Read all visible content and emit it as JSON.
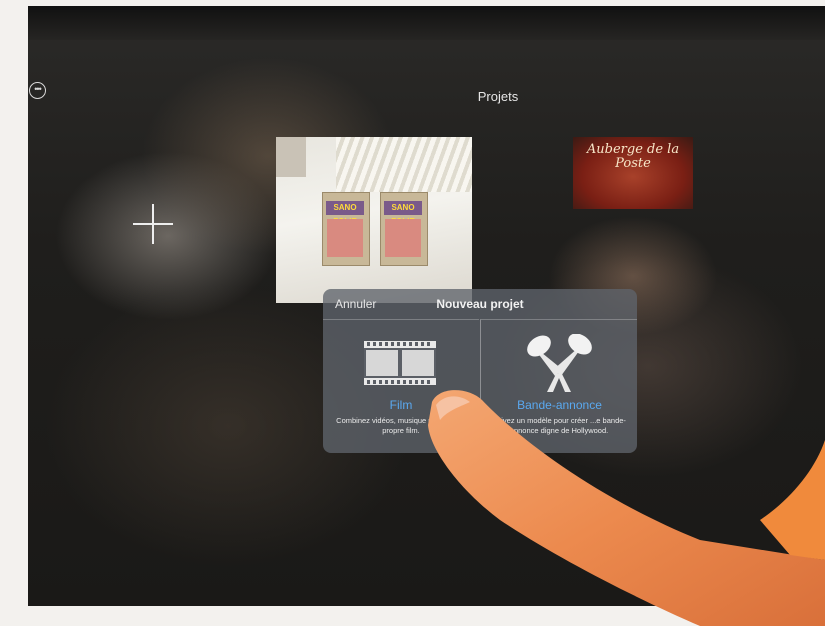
{
  "header": {
    "title": "Projets"
  },
  "projects": {
    "thumb1_book_text": "SANO FOLIE",
    "thumb2_sign_text": "Auberge de la Poste"
  },
  "dialog": {
    "cancel_label": "Annuler",
    "title": "Nouveau projet",
    "options": [
      {
        "label": "Film",
        "description": "Combinez vidéos, musique pour réali... propre film.",
        "icon": "film-strip-icon"
      },
      {
        "label": "Bande-annonce",
        "description": "Suivez un modèle pour créer ...e bande-annonce digne de Hollywood.",
        "icon": "searchlights-icon"
      }
    ]
  },
  "colors": {
    "accent": "#5aa9f0",
    "dialog_bg": "#5f646c",
    "screen_bg": "#1f1e1c"
  }
}
